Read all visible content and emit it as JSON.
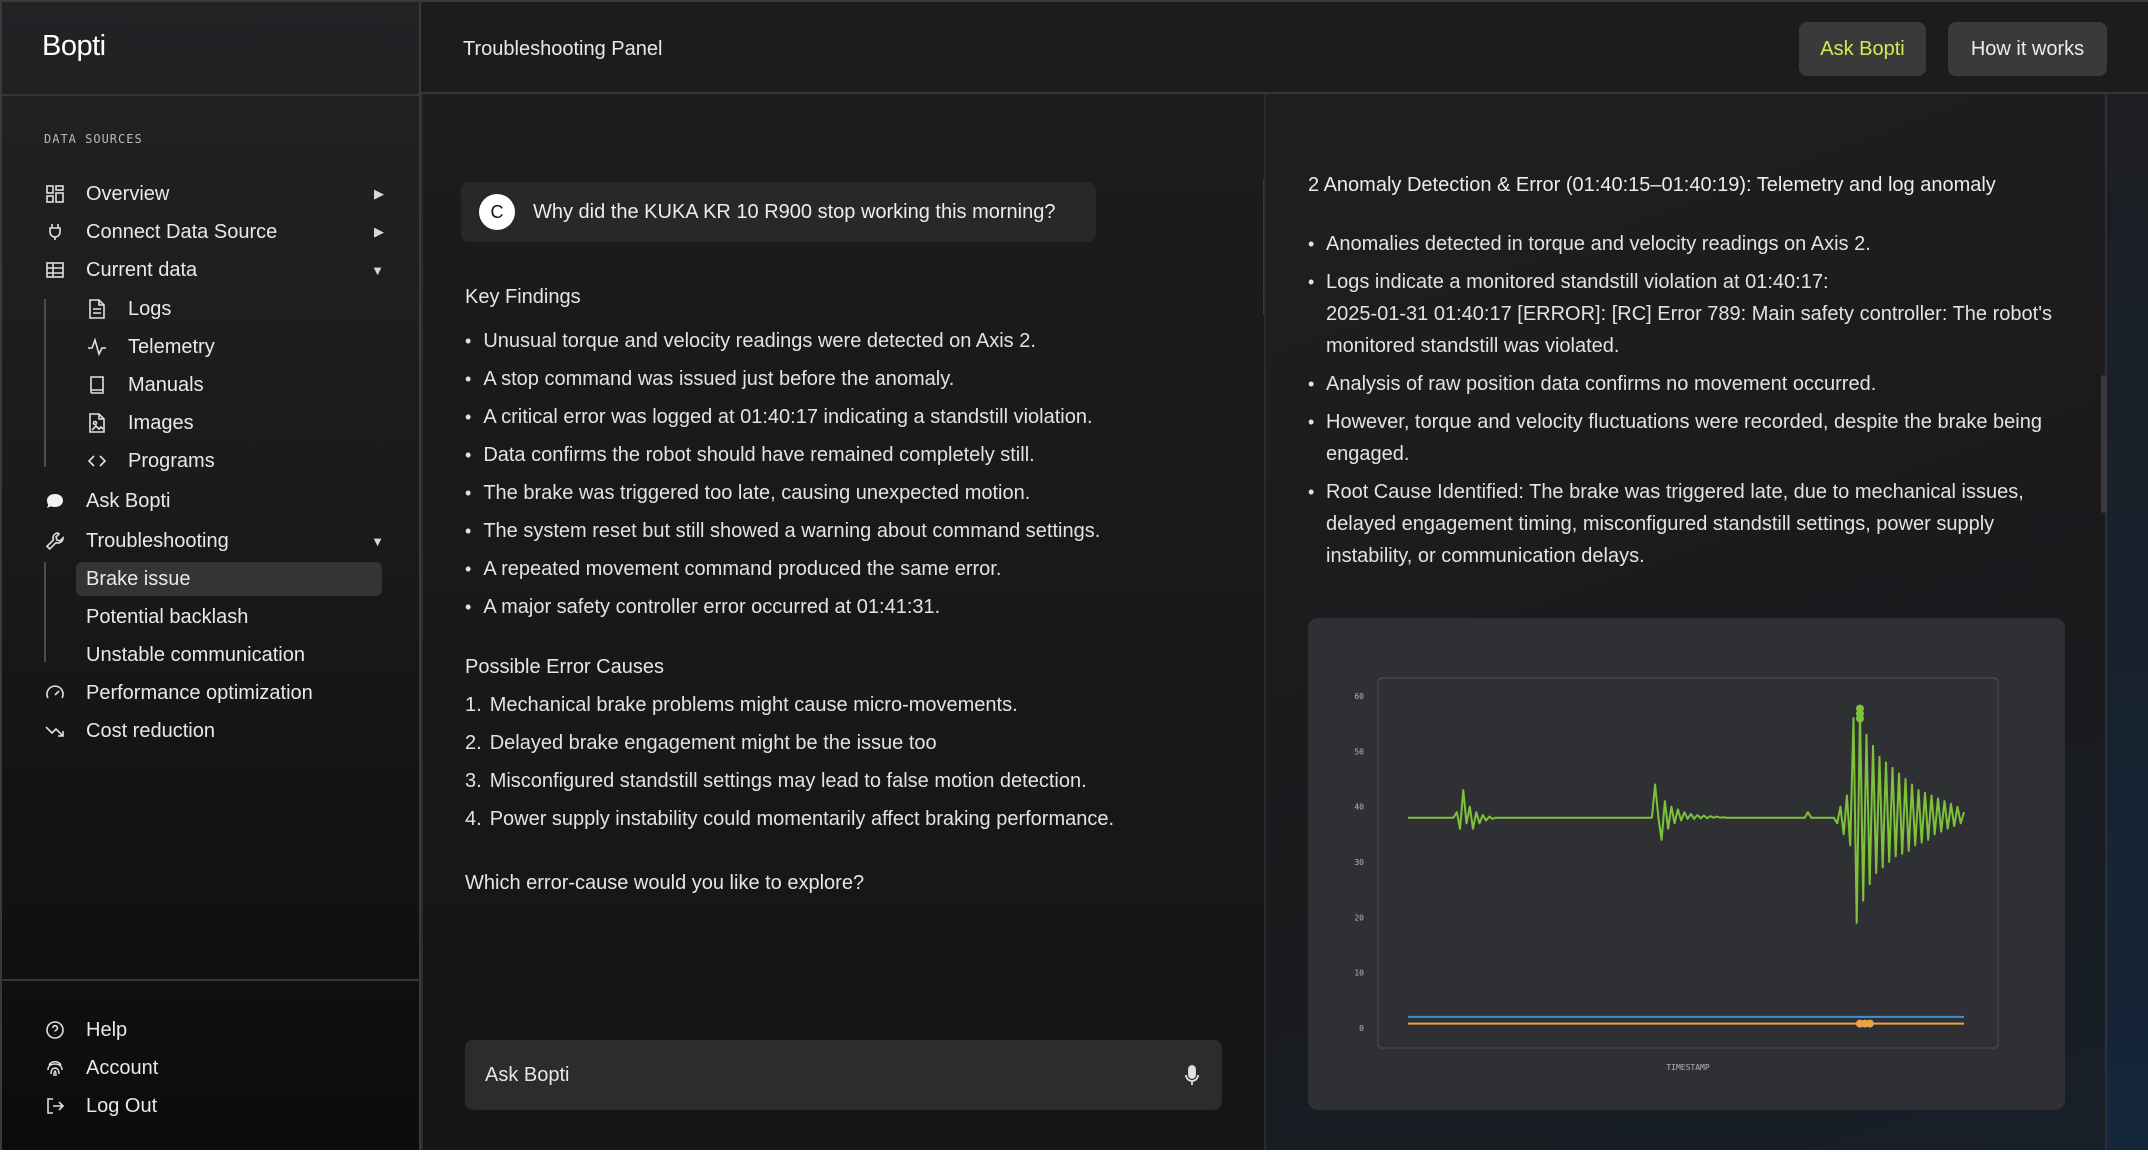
{
  "app": {
    "brand": "Bopti"
  },
  "sidebar": {
    "section_label": "DATA SOURCES",
    "overview": "Overview",
    "connect": "Connect Data Source",
    "current_data": "Current data",
    "current_children": [
      "Logs",
      "Telemetry",
      "Manuals",
      "Images",
      "Programs"
    ],
    "ask": "Ask Bopti",
    "troubleshooting": "Troubleshooting",
    "trouble_children": [
      "Brake issue",
      "Potential backlash",
      "Unstable communication"
    ],
    "performance": "Performance optimization",
    "cost": "Cost reduction",
    "bottom": [
      "Help",
      "Account",
      "Log Out"
    ]
  },
  "header": {
    "title": "Troubleshooting Panel",
    "ask_button": "Ask Bopti",
    "how_button": "How it works"
  },
  "chat": {
    "avatar_initial": "C",
    "question": "Why did the  KUKA KR 10 R900 stop working this morning?",
    "key_findings_title": "Key Findings",
    "key_findings": [
      "Unusual torque and velocity readings were detected on Axis 2.",
      "A stop command was issued just before the anomaly.",
      "A critical error was logged at 01:40:17 indicating a standstill violation.",
      "Data confirms the robot should have remained completely still.",
      "The brake was triggered too late, causing unexpected motion.",
      "The system reset but still showed a warning about command settings.",
      "A repeated movement command produced the same error.",
      "A major safety controller error occurred at 01:41:31."
    ],
    "causes_title": "Possible Error Causes",
    "causes": [
      {
        "n": "1.",
        "text": "Mechanical brake problems might cause micro-movements."
      },
      {
        "n": "2.",
        "text": "Delayed brake engagement might be the issue too"
      },
      {
        "n": "3.",
        "text": "Misconfigured standstill settings may lead to false motion detection."
      },
      {
        "n": "4.",
        "text": "Power supply instability could momentarily affect braking performance."
      }
    ],
    "prompt": "Which error-cause would you like to explore?",
    "input_placeholder": "Ask Bopti"
  },
  "detail": {
    "section_title": "2  Anomaly Detection & Error (01:40:15–01:40:19): Telemetry and log anomaly",
    "bullets": [
      "Anomalies detected in torque and velocity readings on Axis 2.",
      "Logs indicate a monitored standstill violation at 01:40:17:",
      "2025-01-31 01:40:17 [ERROR]: [RC] Error 789: Main safety controller: The robot's monitored standstill was violated.",
      "Analysis of raw position data confirms no movement occurred.",
      "However, torque and velocity fluctuations were recorded, despite the brake being engaged.",
      "Root Cause Identified: The brake was triggered late, due to mechanical issues, delayed engagement timing, misconfigured standstill settings, power supply instability, or communication delays."
    ]
  },
  "chart_data": {
    "type": "line",
    "xlabel": "TIMESTAMP",
    "ylabel": "",
    "ylim": [
      0,
      60
    ],
    "yticks": [
      0,
      10,
      20,
      30,
      40,
      50,
      60
    ],
    "grid": false,
    "series": [
      {
        "color": "#7ec23a",
        "values": [
          38,
          38,
          38,
          38,
          38,
          38,
          38,
          38,
          38,
          38,
          38,
          38,
          38,
          38,
          38,
          39,
          36,
          43,
          37,
          40,
          36,
          39,
          37,
          38.5,
          37.5,
          38.2,
          37.8,
          38,
          38,
          38,
          38,
          38,
          38,
          38,
          38,
          38,
          38,
          38,
          38,
          38,
          38,
          38,
          38,
          38,
          38,
          38,
          38,
          38,
          38,
          38,
          38,
          38,
          38,
          38,
          38,
          38,
          38,
          38,
          38,
          38,
          38,
          38,
          38,
          38,
          38,
          38,
          38,
          38,
          38,
          38,
          38,
          38,
          38,
          38,
          38,
          38,
          44,
          38,
          34,
          41,
          36,
          40,
          37,
          39.5,
          37.5,
          39,
          37.8,
          38.7,
          37.8,
          38.5,
          37.9,
          38.4,
          37.9,
          38.3,
          38,
          38.2,
          38,
          38.1,
          38,
          38,
          38,
          38,
          38,
          38,
          38,
          38,
          38,
          38,
          38,
          38,
          38,
          38,
          38,
          38,
          38,
          38,
          38,
          38,
          38,
          38,
          38,
          38,
          38,
          39,
          38,
          38,
          38,
          38,
          38,
          38,
          38,
          38,
          37,
          40,
          35,
          42,
          33,
          56,
          19,
          57,
          23,
          53,
          26,
          51,
          28,
          49,
          29,
          48,
          30,
          47,
          31,
          46,
          31.5,
          45,
          32,
          44,
          33,
          43,
          33.5,
          42.5,
          34,
          42,
          35,
          41.5,
          35.5,
          41,
          36,
          40.5,
          36.5,
          40,
          37,
          39
        ]
      },
      {
        "color": "#3e8fd8",
        "values": [
          2,
          2,
          2,
          2,
          2,
          2,
          2,
          2,
          2,
          2,
          2,
          2,
          2,
          2,
          2,
          2,
          2,
          2,
          2,
          2,
          2,
          2,
          2,
          2,
          2,
          2,
          2,
          2,
          2,
          2,
          2,
          2,
          2,
          2,
          2,
          2,
          2,
          2,
          2,
          2,
          2,
          2,
          2,
          2,
          2,
          2,
          2,
          2,
          2,
          2,
          2,
          2,
          2,
          2,
          2,
          2,
          2,
          2,
          2,
          2,
          2,
          2,
          2,
          2,
          2,
          2,
          2,
          2,
          2,
          2,
          2,
          2,
          2,
          2,
          2,
          2,
          2,
          2,
          2,
          2,
          2,
          2,
          2,
          2,
          2,
          2,
          2,
          2,
          2,
          2,
          2,
          2,
          2,
          2,
          2,
          2,
          2,
          2,
          2,
          2,
          2,
          2,
          2,
          2,
          2,
          2,
          2,
          2,
          2,
          2,
          2,
          2,
          2,
          2,
          2,
          2,
          2,
          2,
          2,
          2,
          2,
          2,
          2,
          2,
          2,
          2,
          2,
          2,
          2,
          2,
          2,
          2,
          2,
          2,
          2,
          2,
          2,
          2,
          2,
          2,
          2,
          2,
          2,
          2,
          2,
          2,
          2,
          2,
          2,
          2,
          2,
          2,
          2,
          2,
          2,
          2,
          2,
          2,
          2,
          2,
          2,
          2,
          2,
          2,
          2,
          2,
          2,
          2,
          2,
          2
        ]
      },
      {
        "color": "#e8a44a",
        "values": [
          0.8,
          0.8,
          0.8,
          0.8,
          0.8,
          0.8,
          0.8,
          0.8,
          0.8,
          0.8,
          0.8,
          0.8,
          0.8,
          0.8,
          0.8,
          0.8,
          0.8,
          0.8,
          0.8,
          0.8,
          0.8,
          0.8,
          0.8,
          0.8,
          0.8,
          0.8,
          0.8,
          0.8,
          0.8,
          0.8,
          0.8,
          0.8,
          0.8,
          0.8,
          0.8,
          0.8,
          0.8,
          0.8,
          0.8,
          0.8,
          0.8,
          0.8,
          0.8,
          0.8,
          0.8,
          0.8,
          0.8,
          0.8,
          0.8,
          0.8,
          0.8,
          0.8,
          0.8,
          0.8,
          0.8,
          0.8,
          0.8,
          0.8,
          0.8,
          0.8,
          0.8,
          0.8,
          0.8,
          0.8,
          0.8,
          0.8,
          0.8,
          0.8,
          0.8,
          0.8,
          0.8,
          0.8,
          0.8,
          0.8,
          0.8,
          0.8,
          0.8,
          0.8,
          0.8,
          0.8,
          0.8,
          0.8,
          0.8,
          0.8,
          0.8,
          0.8,
          0.8,
          0.8,
          0.8,
          0.8,
          0.8,
          0.8,
          0.8,
          0.8,
          0.8,
          0.8,
          0.8,
          0.8,
          0.8,
          0.8,
          0.8,
          0.8,
          0.8,
          0.8,
          0.8,
          0.8,
          0.8,
          0.8,
          0.8,
          0.8,
          0.8,
          0.8,
          0.8,
          0.8,
          0.8,
          0.8,
          0.8,
          0.8,
          0.8,
          0.8,
          0.8,
          0.8,
          0.8,
          0.8,
          0.8,
          0.8,
          0.8,
          0.8,
          0.8,
          0.8,
          0.8,
          0.8,
          0.8,
          0.8,
          0.8,
          0.8,
          0.8,
          0.8,
          0.8,
          0.8,
          0.8,
          0.8,
          0.8,
          0.8,
          0.8,
          0.8,
          0.8,
          0.8,
          0.8,
          0.8,
          0.8,
          0.8,
          0.8,
          0.8,
          0.8,
          0.8,
          0.8,
          0.8,
          0.8,
          0.8,
          0.8,
          0.8,
          0.8,
          0.8,
          0.8,
          0.8,
          0.8,
          0.8
        ]
      }
    ]
  }
}
